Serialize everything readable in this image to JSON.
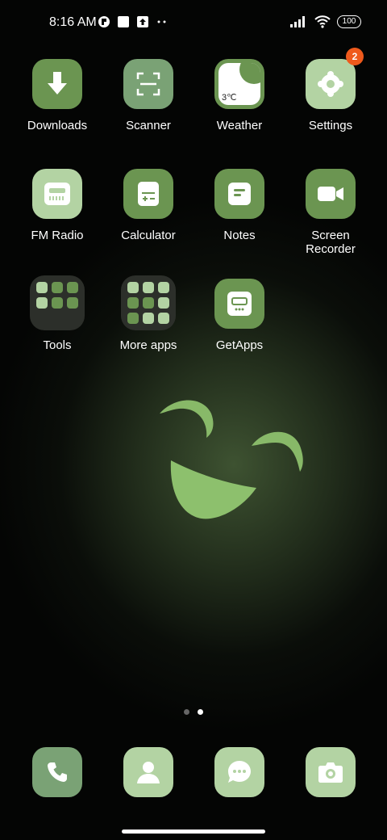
{
  "status_bar": {
    "time": "8:16 AM",
    "battery": "100"
  },
  "apps": [
    {
      "label": "Downloads",
      "icon": "download-icon"
    },
    {
      "label": "Scanner",
      "icon": "scanner-icon"
    },
    {
      "label": "Weather",
      "icon": "weather-icon",
      "icon_text": "3℃"
    },
    {
      "label": "Settings",
      "icon": "gear-icon",
      "badge": "2"
    },
    {
      "label": "FM Radio",
      "icon": "radio-icon"
    },
    {
      "label": "Calculator",
      "icon": "calculator-icon"
    },
    {
      "label": "Notes",
      "icon": "notes-icon"
    },
    {
      "label": "Screen Recorder",
      "label_line1": "Screen",
      "label_line2": "Recorder",
      "icon": "video-camera-icon"
    },
    {
      "label": "Tools",
      "icon": "folder-icon"
    },
    {
      "label": "More apps",
      "icon": "folder-icon"
    },
    {
      "label": "GetApps",
      "icon": "getapps-icon"
    }
  ],
  "page_indicator": {
    "pages": 2,
    "active": 2
  },
  "dock": [
    {
      "icon": "phone-icon"
    },
    {
      "icon": "contacts-icon"
    },
    {
      "icon": "messages-icon"
    },
    {
      "icon": "camera-icon"
    }
  ],
  "colors": {
    "icon_dark_green": "#6b9551",
    "icon_mid_green": "#7aa275",
    "icon_light_green": "#b3d3a3",
    "badge": "#ef5a1c"
  }
}
